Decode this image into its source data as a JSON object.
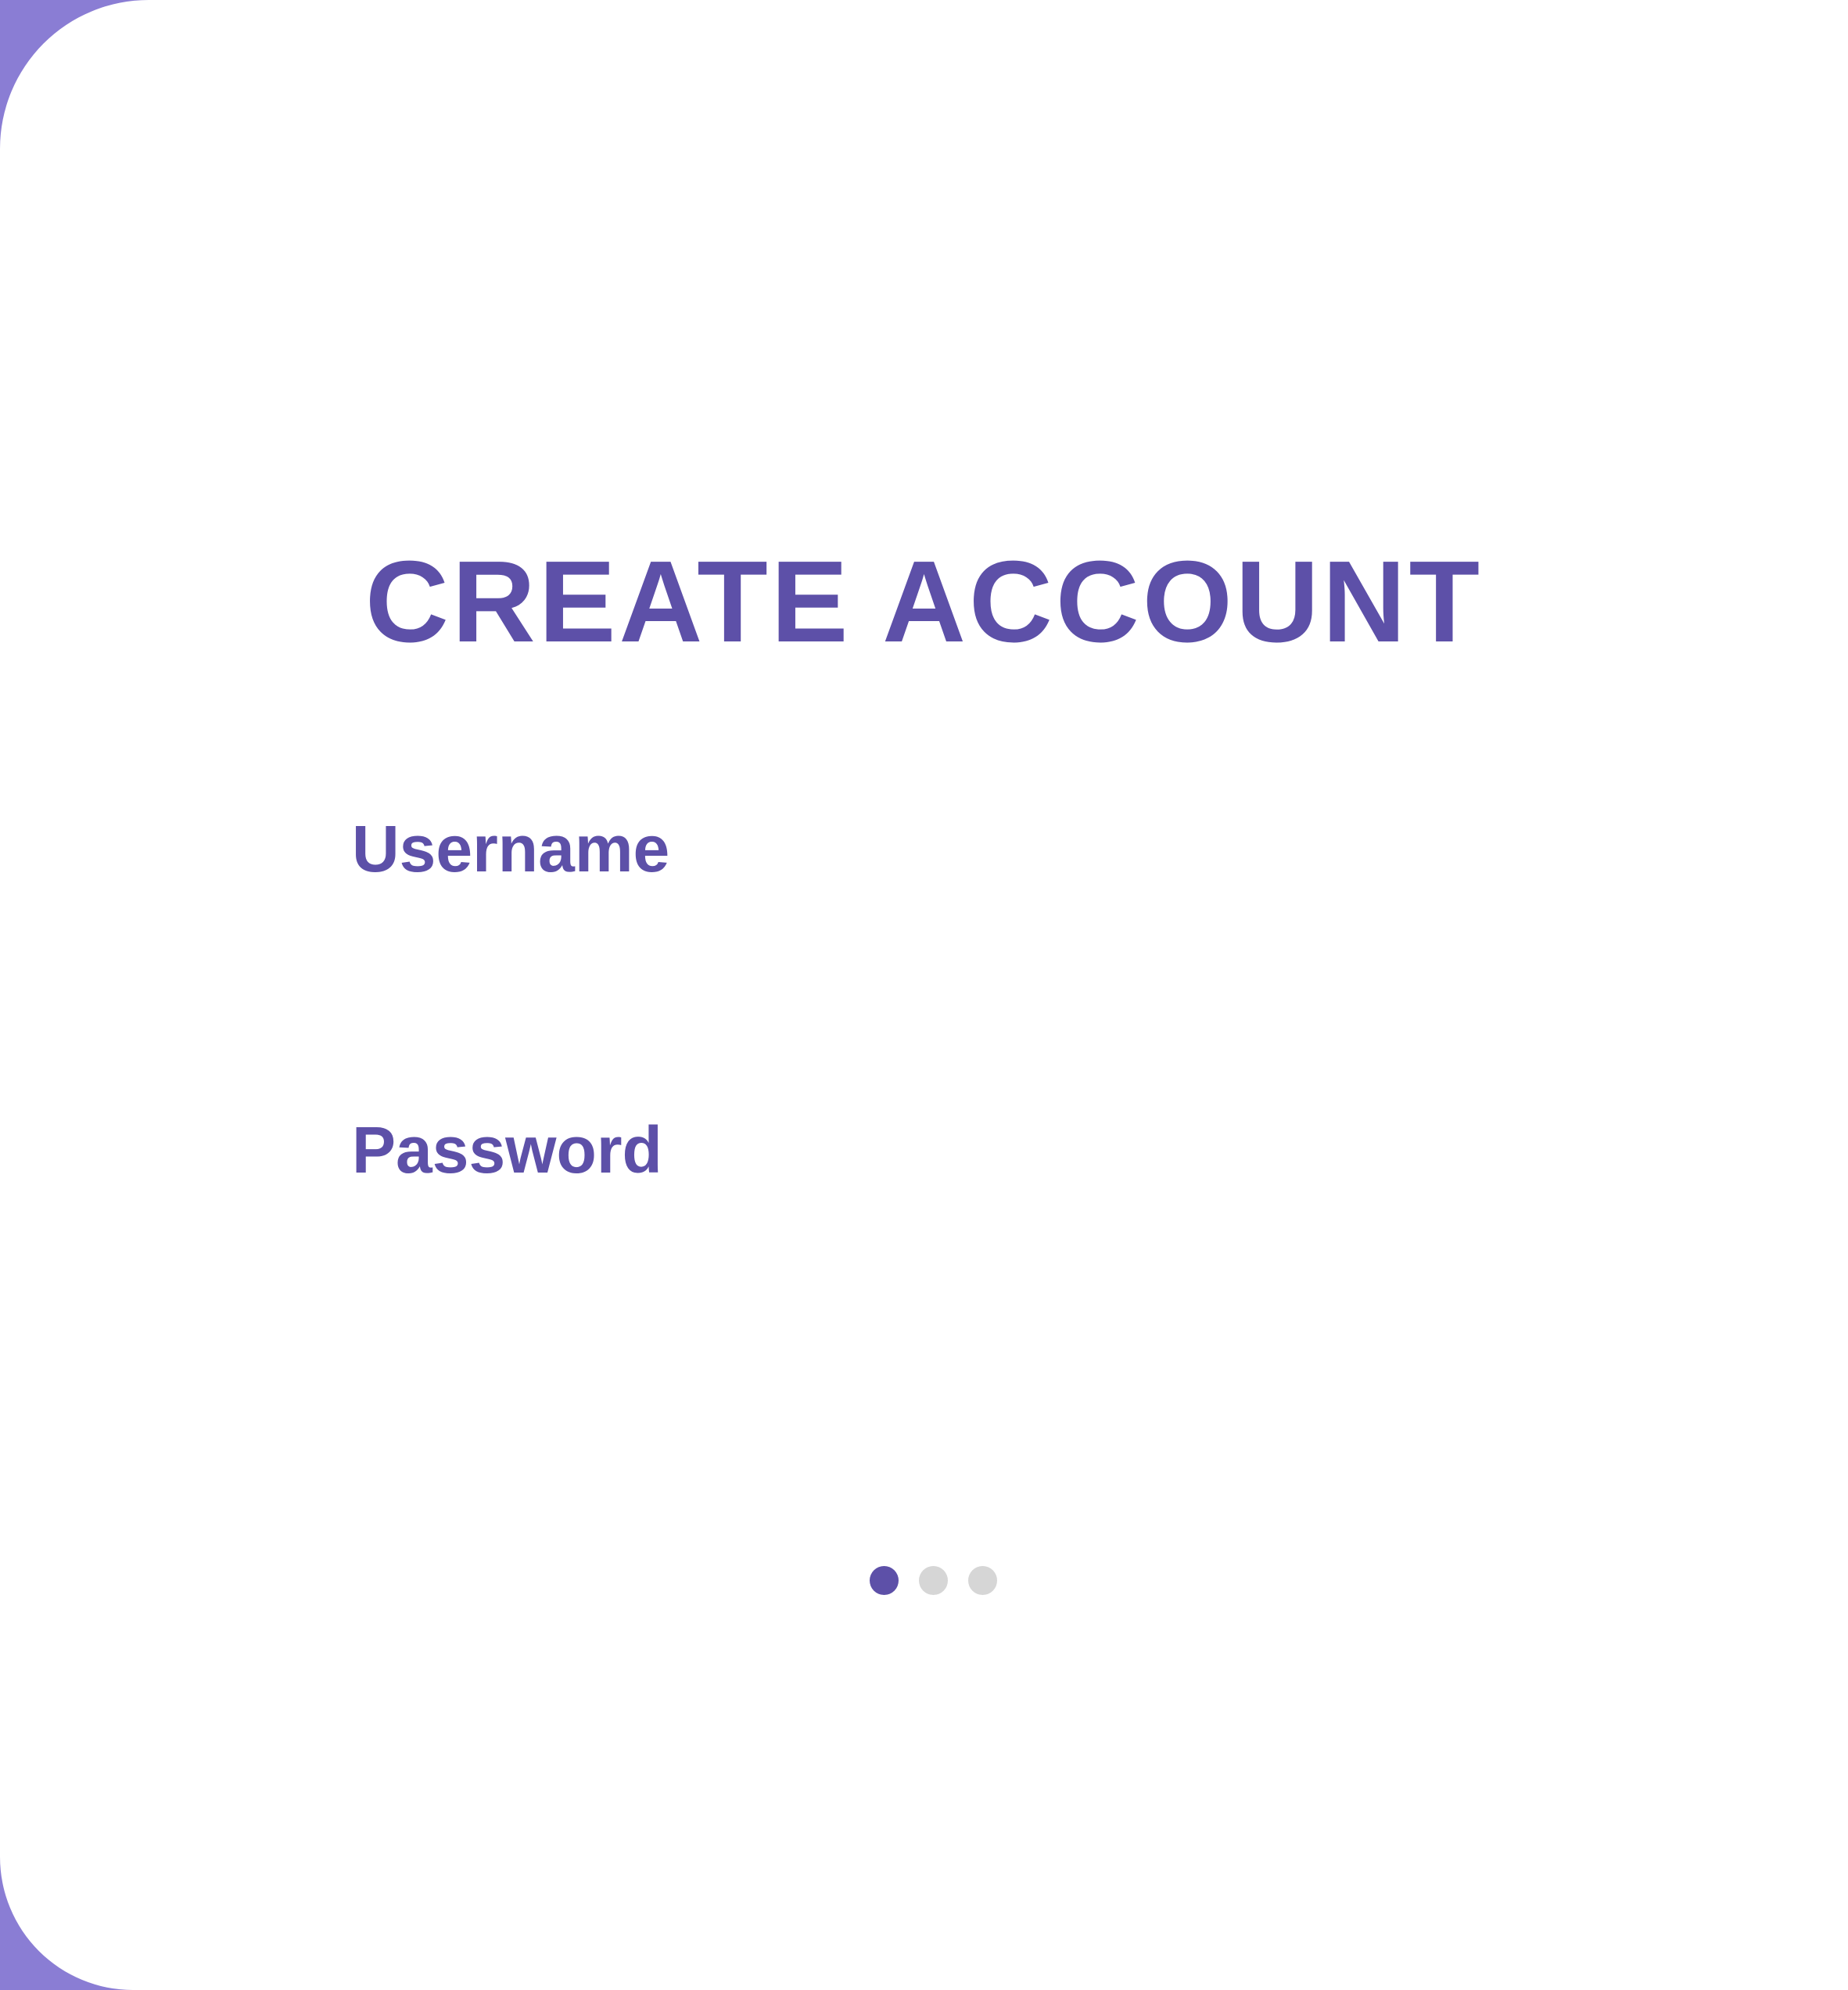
{
  "colors": {
    "accent": "#5d50a8",
    "background_edge": "#8a7dd4",
    "card": "#ffffff",
    "dot_inactive": "#d6d6d6"
  },
  "form": {
    "title": "CREATE ACCOUNT",
    "username": {
      "label": "Username",
      "value": ""
    },
    "password": {
      "label": "Password",
      "value": ""
    }
  },
  "pagination": {
    "total": 3,
    "active_index": 0
  }
}
